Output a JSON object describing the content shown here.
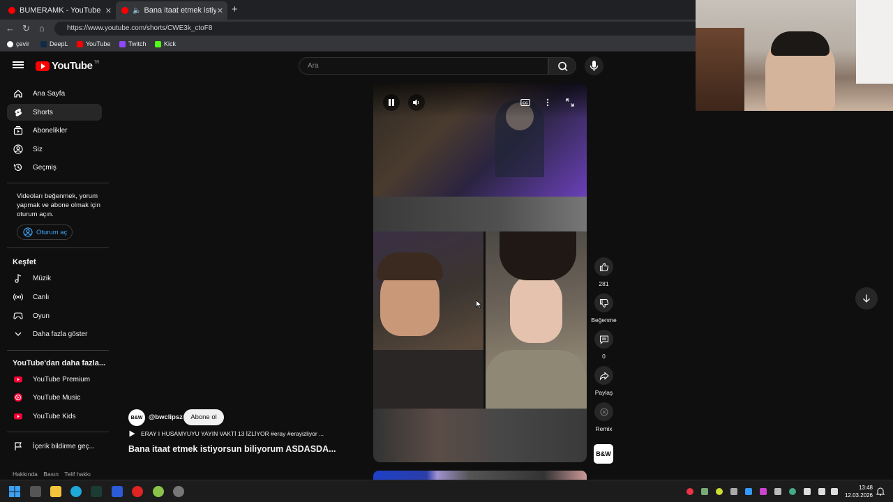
{
  "browser": {
    "tabs": [
      {
        "title": "BUMERAMK - YouTube"
      },
      {
        "title": "Bana itaat etmek istiyorsun bi"
      }
    ],
    "url": "https://www.youtube.com/shorts/CWE3k_ctoF8",
    "bookmarks": [
      {
        "label": "çevir",
        "color": "#ffffff"
      },
      {
        "label": "DeepL",
        "color": "#0f2b46"
      },
      {
        "label": "YouTube",
        "color": "#ff0000"
      },
      {
        "label": "Twitch",
        "color": "#9146ff"
      },
      {
        "label": "Kick",
        "color": "#53fc18"
      }
    ]
  },
  "header": {
    "logo_text": "YouTube",
    "country": "TR",
    "search_placeholder": "Ara"
  },
  "sidebar": {
    "main": [
      {
        "label": "Ana Sayfa",
        "icon": "home-icon"
      },
      {
        "label": "Shorts",
        "icon": "shorts-icon"
      },
      {
        "label": "Abonelikler",
        "icon": "subscriptions-icon"
      },
      {
        "label": "Siz",
        "icon": "user-icon"
      },
      {
        "label": "Geçmiş",
        "icon": "history-icon"
      }
    ],
    "signin_prompt": "Videoları beğenmek, yorum yapmak ve abone olmak için oturum açın.",
    "signin_button": "Oturum aç",
    "explore_title": "Keşfet",
    "explore": [
      {
        "label": "Müzik",
        "icon": "music-icon"
      },
      {
        "label": "Canlı",
        "icon": "live-icon"
      },
      {
        "label": "Oyun",
        "icon": "gaming-icon"
      },
      {
        "label": "Daha fazla göster",
        "icon": "chevron-down-icon"
      }
    ],
    "more_title": "YouTube'dan daha fazla...",
    "more": [
      {
        "label": "YouTube Premium"
      },
      {
        "label": "YouTube Music"
      },
      {
        "label": "YouTube Kids"
      }
    ],
    "report": "İçerik bildirme geç...",
    "footer": [
      "Hakkında",
      "Basın",
      "Telif hakkı"
    ]
  },
  "short": {
    "channel_avatar": "B&W",
    "channel": "@bwclipsz",
    "subscribe": "Abone ol",
    "description": "ERAY I HUSAMYUYU YAYIN VAKTİ 13 İZLİYOR #eray #erayizliyor ...",
    "title": "Bana itaat etmek istiyorsun biliyorum ASDASDA...",
    "likes": "281",
    "dislike_label": "Beğenme",
    "comments": "0",
    "share_label": "Paylaş",
    "remix_label": "Remix",
    "sound_thumb": "B&W"
  },
  "taskbar": {
    "time": "13:48",
    "date": "12.03.2026"
  }
}
